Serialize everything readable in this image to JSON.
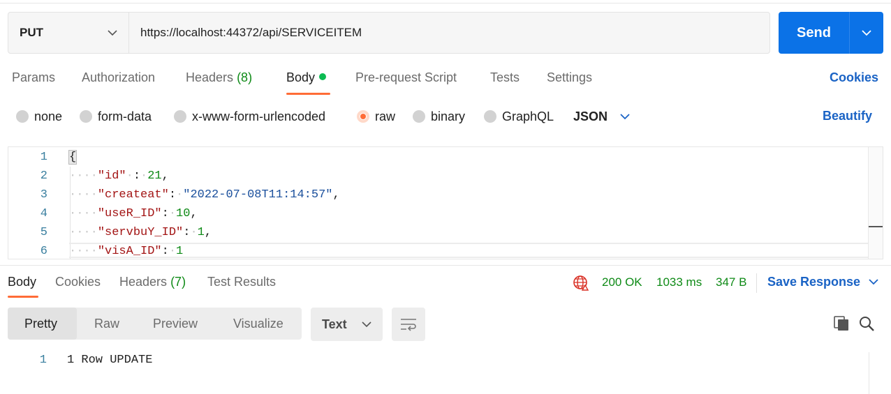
{
  "request": {
    "method": "PUT",
    "url": "https://localhost:44372/api/SERVICEITEM",
    "send_label": "Send"
  },
  "request_tabs": [
    {
      "label": "Params"
    },
    {
      "label": "Authorization"
    },
    {
      "label": "Headers",
      "count": "(8)"
    },
    {
      "label": "Body"
    },
    {
      "label": "Pre-request Script"
    },
    {
      "label": "Tests"
    },
    {
      "label": "Settings"
    }
  ],
  "cookies_link": "Cookies",
  "body_types": [
    "none",
    "form-data",
    "x-www-form-urlencoded",
    "raw",
    "binary",
    "GraphQL"
  ],
  "selected_body_type": "raw",
  "format": "JSON",
  "beautify": "Beautify",
  "editor": {
    "line_numbers": [
      "1",
      "2",
      "3",
      "4",
      "5",
      "6"
    ],
    "lines": {
      "l1": "{",
      "k2": "\"id\"",
      "v2": "21",
      "k3": "\"createat\"",
      "v3": "\"2022-07-08T11:14:57\"",
      "k4": "\"useR_ID\"",
      "v4": "10",
      "k5": "\"servbuY_ID\"",
      "v5": "1",
      "k6": "\"visA_ID\"",
      "v6": "1"
    }
  },
  "response_tabs": [
    {
      "label": "Body"
    },
    {
      "label": "Cookies"
    },
    {
      "label": "Headers",
      "count": "(7)"
    },
    {
      "label": "Test Results"
    }
  ],
  "status": {
    "code": "200 OK",
    "time": "1033 ms",
    "size": "347 B"
  },
  "save_response": "Save Response",
  "view_modes": [
    "Pretty",
    "Raw",
    "Preview",
    "Visualize"
  ],
  "response_format": "Text",
  "response_body": {
    "line_number": "1",
    "text": "1 Row UPDATE"
  },
  "colors": {
    "accent": "#ff6c37",
    "primary": "#0b72e7",
    "link": "#1a63c5",
    "success": "#0e8a16"
  }
}
